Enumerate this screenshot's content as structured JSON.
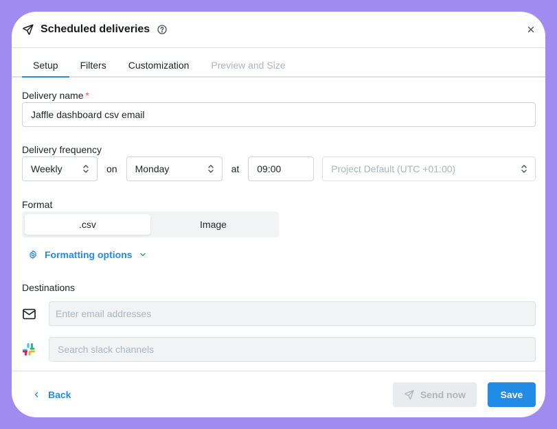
{
  "modal": {
    "title": "Scheduled deliveries"
  },
  "tabs": [
    {
      "label": "Setup",
      "state": "active"
    },
    {
      "label": "Filters",
      "state": "normal"
    },
    {
      "label": "Customization",
      "state": "normal"
    },
    {
      "label": "Preview and Size",
      "state": "disabled"
    }
  ],
  "delivery_name": {
    "label": "Delivery name",
    "required_marker": "*",
    "value": "Jaffle dashboard csv email"
  },
  "delivery_frequency": {
    "label": "Delivery frequency",
    "frequency": "Weekly",
    "on_word": "on",
    "day": "Monday",
    "at_word": "at",
    "time": "09:00",
    "timezone_placeholder": "Project Default (UTC +01:00)"
  },
  "format": {
    "label": "Format",
    "options": [
      ".csv",
      "Image"
    ],
    "selected": ".csv"
  },
  "formatting_options": {
    "label": "Formatting options"
  },
  "destinations": {
    "label": "Destinations",
    "email_placeholder": "Enter email addresses",
    "slack_placeholder": "Search slack channels"
  },
  "footer": {
    "back_label": "Back",
    "send_now_label": "Send now",
    "save_label": "Save"
  },
  "colors": {
    "accent": "#228be6",
    "background": "#a08cf0",
    "required": "#fa5252",
    "slack": [
      "#36c5f0",
      "#2eb67d",
      "#ecb22e",
      "#e01e5a"
    ]
  },
  "icons": {
    "title": "paper-plane-icon",
    "help": "question-circle-icon",
    "close": "close-icon",
    "select": "chevron-up-down-icon",
    "formatting": "gear-icon",
    "formatting_toggle": "chevron-down-icon",
    "email": "mail-icon",
    "slack": "slack-icon",
    "back": "chevron-left-icon",
    "send": "paper-plane-icon"
  }
}
